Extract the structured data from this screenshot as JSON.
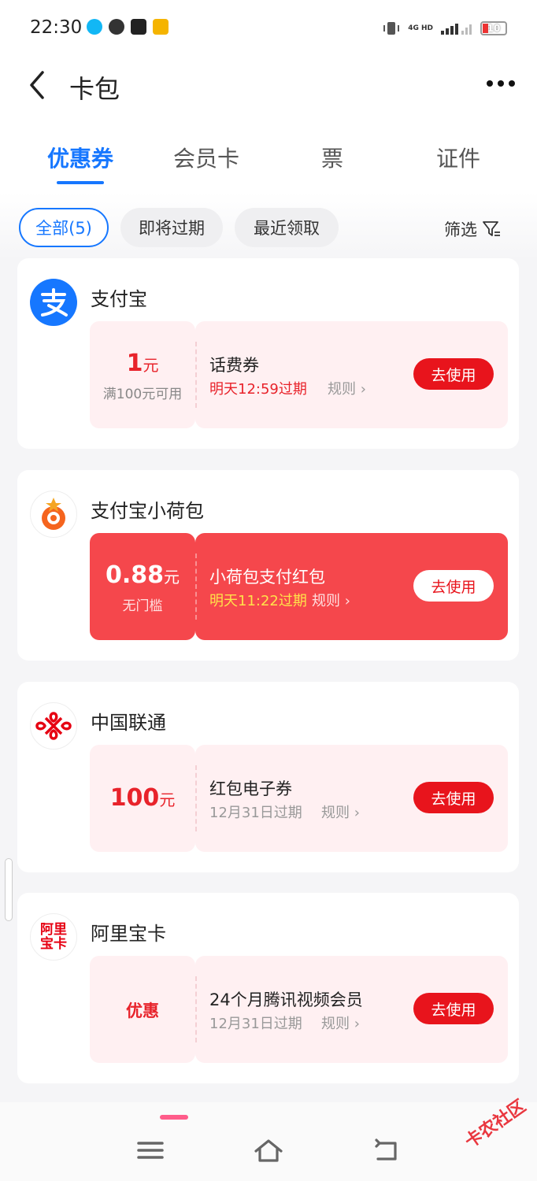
{
  "status_bar": {
    "time": "22:30",
    "network": "4G HD",
    "battery": "10"
  },
  "app_bar": {
    "title": "卡包"
  },
  "tabs": [
    {
      "label": "优惠券",
      "active": true
    },
    {
      "label": "会员卡",
      "active": false
    },
    {
      "label": "票",
      "active": false
    },
    {
      "label": "证件",
      "active": false
    }
  ],
  "filters": {
    "chips": [
      {
        "label": "全部(5)",
        "active": true
      },
      {
        "label": "即将过期",
        "active": false
      },
      {
        "label": "最近领取",
        "active": false
      }
    ],
    "filter_label": "筛选"
  },
  "cards": [
    {
      "merchant": "支付宝",
      "amount": "1",
      "unit": "元",
      "condition": "满100元可用",
      "title": "话费券",
      "expire": "明天12:59过期",
      "rules": "规则 ›",
      "action": "去使用"
    },
    {
      "merchant": "支付宝小荷包",
      "amount": "0.88",
      "unit": "元",
      "condition": "无门槛",
      "title": "小荷包支付红包",
      "expire": "明天11:22过期",
      "rules": "规则 ›",
      "action": "去使用"
    },
    {
      "merchant": "中国联通",
      "amount": "100",
      "unit": "元",
      "condition": "",
      "title": "红包电子券",
      "expire": "12月31日过期",
      "rules": "规则 ›",
      "action": "去使用"
    },
    {
      "merchant": "阿里宝卡",
      "logo_text": "阿里宝卡",
      "amount_label": "优惠",
      "title": "24个月腾讯视频会员",
      "expire": "12月31日过期",
      "rules": "规则 ›",
      "action": "去使用"
    }
  ],
  "watermark": "卡农社区",
  "colors": {
    "accent_blue": "#1677ff",
    "coupon_red": "#e8232b",
    "red_coupon_bg": "#f5474c",
    "coupon_pink_bg": "#fff0f2"
  }
}
